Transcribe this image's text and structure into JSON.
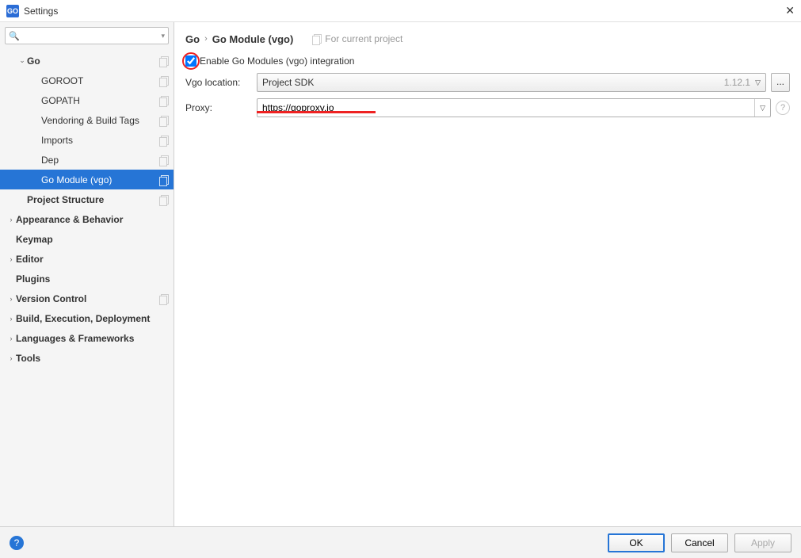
{
  "window": {
    "title": "Settings",
    "app_icon_text": "GO"
  },
  "search": {
    "placeholder": ""
  },
  "tree": {
    "items": [
      {
        "label": "Go",
        "depth": 1,
        "arrow": "down",
        "bold": true,
        "copy": true,
        "name": "tree-go"
      },
      {
        "label": "GOROOT",
        "depth": 2,
        "arrow": "",
        "bold": false,
        "copy": true,
        "name": "tree-goroot"
      },
      {
        "label": "GOPATH",
        "depth": 2,
        "arrow": "",
        "bold": false,
        "copy": true,
        "name": "tree-gopath"
      },
      {
        "label": "Vendoring & Build Tags",
        "depth": 2,
        "arrow": "",
        "bold": false,
        "copy": true,
        "name": "tree-vendoring"
      },
      {
        "label": "Imports",
        "depth": 2,
        "arrow": "",
        "bold": false,
        "copy": true,
        "name": "tree-imports"
      },
      {
        "label": "Dep",
        "depth": 2,
        "arrow": "",
        "bold": false,
        "copy": true,
        "name": "tree-dep"
      },
      {
        "label": "Go Module (vgo)",
        "depth": 2,
        "arrow": "",
        "bold": false,
        "copy": true,
        "selected": true,
        "name": "tree-go-module"
      },
      {
        "label": "Project Structure",
        "depth": 1,
        "arrow": "",
        "bold": true,
        "copy": true,
        "name": "tree-project-structure"
      },
      {
        "label": "Appearance & Behavior",
        "depth": 0,
        "arrow": "right",
        "bold": true,
        "copy": false,
        "name": "tree-appearance"
      },
      {
        "label": "Keymap",
        "depth": 0,
        "arrow": "",
        "bold": true,
        "copy": false,
        "name": "tree-keymap"
      },
      {
        "label": "Editor",
        "depth": 0,
        "arrow": "right",
        "bold": true,
        "copy": false,
        "name": "tree-editor"
      },
      {
        "label": "Plugins",
        "depth": 0,
        "arrow": "",
        "bold": true,
        "copy": false,
        "name": "tree-plugins"
      },
      {
        "label": "Version Control",
        "depth": 0,
        "arrow": "right",
        "bold": true,
        "copy": true,
        "name": "tree-version-control"
      },
      {
        "label": "Build, Execution, Deployment",
        "depth": 0,
        "arrow": "right",
        "bold": true,
        "copy": false,
        "name": "tree-build"
      },
      {
        "label": "Languages & Frameworks",
        "depth": 0,
        "arrow": "right",
        "bold": true,
        "copy": false,
        "name": "tree-languages"
      },
      {
        "label": "Tools",
        "depth": 0,
        "arrow": "right",
        "bold": true,
        "copy": false,
        "name": "tree-tools"
      }
    ]
  },
  "breadcrumb": {
    "crumb1": "Go",
    "crumb2": "Go Module (vgo)",
    "project_hint": "For current project"
  },
  "form": {
    "enable_label": "Enable Go Modules (vgo) integration",
    "enable_checked": true,
    "vgo_label": "Vgo location:",
    "vgo_value": "Project SDK",
    "vgo_version": "1.12.1",
    "ellipsis": "...",
    "proxy_label": "Proxy:",
    "proxy_value": "https://goproxy.io",
    "help": "?"
  },
  "footer": {
    "ok": "OK",
    "cancel": "Cancel",
    "apply": "Apply",
    "help": "?"
  }
}
